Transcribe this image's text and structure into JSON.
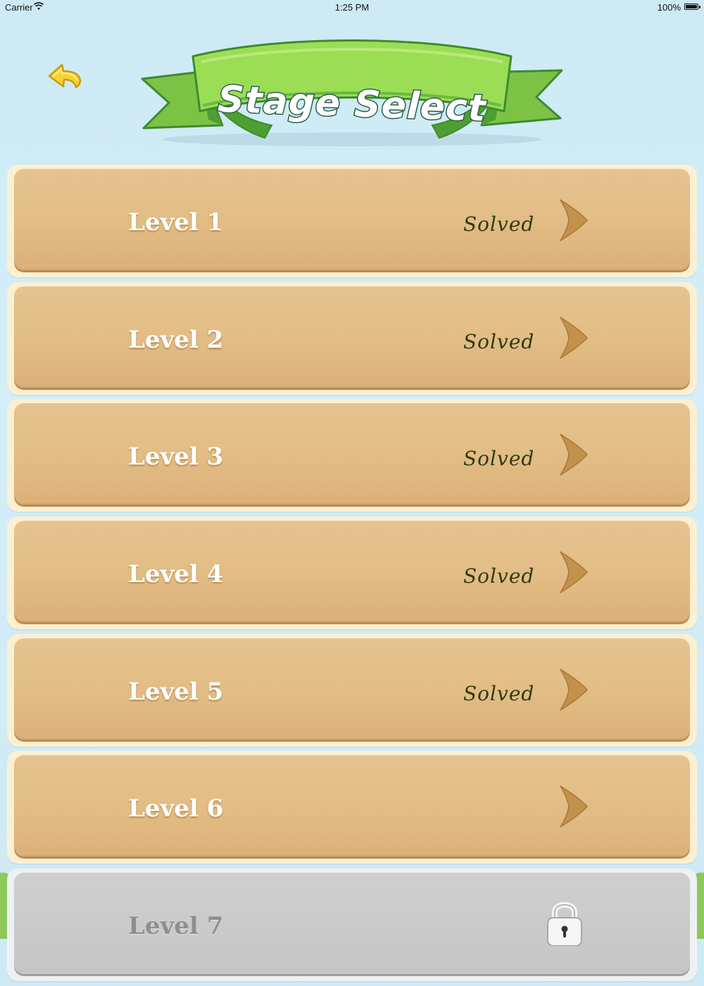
{
  "status_bar": {
    "carrier": "Carrier",
    "time": "1:25 PM",
    "battery": "100%"
  },
  "header": {
    "title": "Stage Select",
    "back_icon": "back-arrow-icon"
  },
  "levels": [
    {
      "label": "Level 1",
      "status": "Solved",
      "locked": false
    },
    {
      "label": "Level 2",
      "status": "Solved",
      "locked": false
    },
    {
      "label": "Level 3",
      "status": "Solved",
      "locked": false
    },
    {
      "label": "Level 4",
      "status": "Solved",
      "locked": false
    },
    {
      "label": "Level 5",
      "status": "Solved",
      "locked": false
    },
    {
      "label": "Level 6",
      "status": "",
      "locked": false
    },
    {
      "label": "Level 7",
      "status": "",
      "locked": true
    }
  ],
  "colors": {
    "sky": "#cfeaf4",
    "banner_green": "#8fd14f",
    "card_tan": "#e2bc84",
    "chevron": "#c3924a",
    "solved_text": "#2f3b12",
    "back_arrow": "#f6cf2e"
  }
}
